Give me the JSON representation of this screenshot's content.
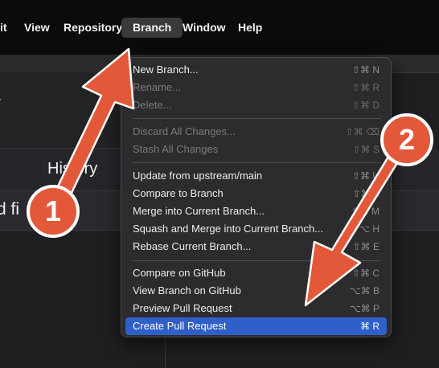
{
  "menubar": {
    "items": [
      {
        "label": "it"
      },
      {
        "label": "View"
      },
      {
        "label": "Repository"
      },
      {
        "label": "Branch"
      },
      {
        "label": "Window"
      },
      {
        "label": "Help"
      }
    ]
  },
  "app": {
    "sidebar_fragment": "y",
    "history_tab": "History",
    "changed_files_fragment": "d fi"
  },
  "menu": {
    "items": [
      {
        "label": "New Branch...",
        "shortcut": "⇧⌘ N"
      },
      {
        "label": "Rename...",
        "shortcut": "⇧⌘ R"
      },
      {
        "label": "Delete...",
        "shortcut": "⇧⌘ D"
      },
      {
        "label": "Discard All Changes...",
        "shortcut": "⇧⌘ ⌫"
      },
      {
        "label": "Stash All Changes",
        "shortcut": "⇧⌘ S"
      },
      {
        "label": "Update from upstream/main",
        "shortcut": "⇧⌘ U"
      },
      {
        "label": "Compare to Branch",
        "shortcut": "⇧⌘ B"
      },
      {
        "label": "Merge into Current Branch...",
        "shortcut": "⇧⌘ M"
      },
      {
        "label": "Squash and Merge into Current Branch...",
        "shortcut": "⇧⌥ H"
      },
      {
        "label": "Rebase Current Branch...",
        "shortcut": "⇧⌘ E"
      },
      {
        "label": "Compare on GitHub",
        "shortcut": "⇧⌘ C"
      },
      {
        "label": "View Branch on GitHub",
        "shortcut": "⌥⌘ B"
      },
      {
        "label": "Preview Pull Request",
        "shortcut": "⌥⌘ P"
      },
      {
        "label": "Create Pull Request",
        "shortcut": "⌘ R"
      }
    ]
  },
  "annotations": {
    "badge1": "1",
    "badge2": "2",
    "arrow_color": "#e4583a"
  }
}
